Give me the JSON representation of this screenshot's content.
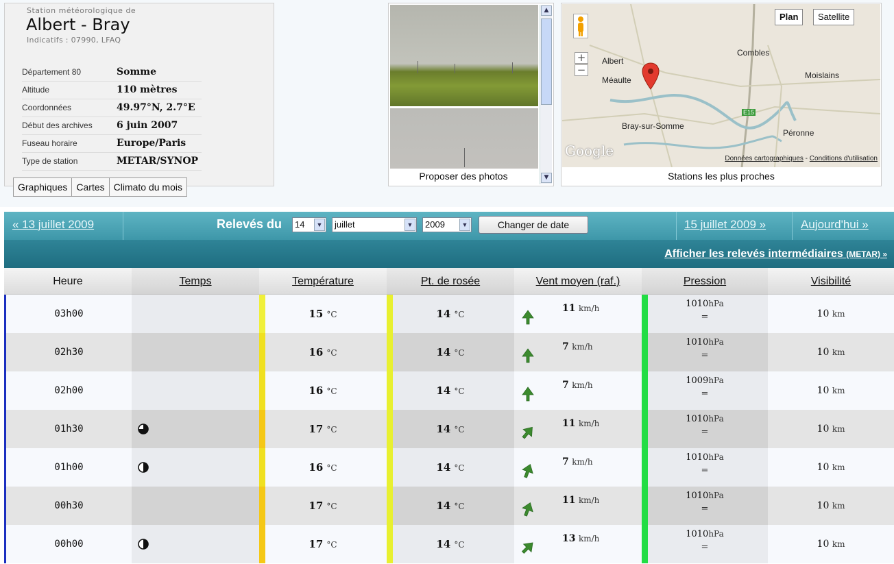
{
  "station": {
    "prefix": "Station météorologique de",
    "name": "Albert - Bray",
    "indicatifs": "Indicatifs : 07990, LFAQ",
    "info": [
      {
        "label": "Département 80",
        "value": "Somme"
      },
      {
        "label": "Altitude",
        "value": "110 mètres"
      },
      {
        "label": "Coordonnées",
        "value": "49.97°N, 2.7°E"
      },
      {
        "label": "Début des archives",
        "value": "6 juin 2007"
      },
      {
        "label": "Fuseau horaire",
        "value": "Europe/Paris"
      },
      {
        "label": "Type de station",
        "value": "METAR/SYNOP"
      }
    ],
    "tabs": [
      "Graphiques",
      "Cartes",
      "Climato du mois"
    ]
  },
  "photos": {
    "caption": "Proposer des photos"
  },
  "map": {
    "type_plan": "Plan",
    "type_satellite": "Satellite",
    "towns": [
      "Albert",
      "Méaulte",
      "Combles",
      "Moislains",
      "Bray-sur-Somme",
      "Péronne"
    ],
    "road_label": "E15",
    "google": "Google",
    "footer_data": "Données cartographiques",
    "footer_sep": " - ",
    "footer_terms": "Conditions d'utilisation",
    "caption": "Stations les plus proches"
  },
  "nav": {
    "prev": "« 13 juillet 2009",
    "releves": "Relevés du",
    "day": "14",
    "month": "juillet",
    "year": "2009",
    "change": "Changer de date",
    "next": "15 juillet 2009 »",
    "today": "Aujourd'hui »",
    "metar_link": "Afficher les relevés intermédiaires",
    "metar_small": "(METAR) »"
  },
  "table": {
    "headers": [
      "Heure",
      "Temps",
      "Température",
      "Pt. de rosée",
      "Vent moyen (raf.)",
      "Pression",
      "Visibilité"
    ],
    "temp_unit": "°C",
    "wind_unit": "km/h",
    "press_unit": "hPa",
    "vis_unit": "km",
    "rows": [
      {
        "hour": "03h00",
        "sky": "",
        "temp": "15",
        "dew": "14",
        "wind": "11",
        "pressure": "1010",
        "trend": "=",
        "vis": "10"
      },
      {
        "hour": "02h30",
        "sky": "",
        "temp": "16",
        "dew": "14",
        "wind": "7",
        "pressure": "1010",
        "trend": "=",
        "vis": "10"
      },
      {
        "hour": "02h00",
        "sky": "",
        "temp": "16",
        "dew": "14",
        "wind": "7",
        "pressure": "1009",
        "trend": "=",
        "vis": "10"
      },
      {
        "hour": "01h30",
        "sky": "cloud-3-8-icon",
        "temp": "17",
        "dew": "14",
        "wind": "11",
        "pressure": "1010",
        "trend": "=",
        "vis": "10"
      },
      {
        "hour": "01h00",
        "sky": "cloud-1-4-icon",
        "temp": "16",
        "dew": "14",
        "wind": "7",
        "pressure": "1010",
        "trend": "=",
        "vis": "10"
      },
      {
        "hour": "00h30",
        "sky": "",
        "temp": "17",
        "dew": "14",
        "wind": "11",
        "pressure": "1010",
        "trend": "=",
        "vis": "10"
      },
      {
        "hour": "00h00",
        "sky": "cloud-1-4-icon",
        "temp": "17",
        "dew": "14",
        "wind": "13",
        "pressure": "1010",
        "trend": "=",
        "vis": "10"
      }
    ]
  },
  "colors": {
    "nav_top": "#4aa6b8",
    "nav_bottom": "#2a7a8c",
    "temp15": "#f0f03a",
    "temp16": "#f0e020",
    "temp17": "#f5c816",
    "dew14": "#e8f030",
    "press_bar": "#22dd44",
    "row_rule": "#1b2fc0"
  }
}
